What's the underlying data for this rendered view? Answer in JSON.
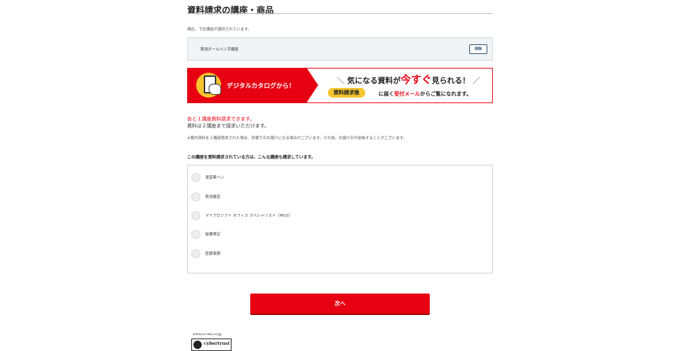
{
  "page": {
    "title": "資料請求の講座・商品",
    "current_note": "現在、下記講座が選択されています。"
  },
  "selected": {
    "course_name": "実用ボールペン字講座",
    "delete_label": "削除"
  },
  "banner": {
    "left_text": "デジタルカタログから！",
    "headline_prefix": "気になる資料が",
    "headline_emphasis": "今すぐ",
    "headline_suffix": "見られる！",
    "slash_left": "＼",
    "slash_right": "／",
    "pill": "資料請求後",
    "sub_prefix": "に届く",
    "sub_red": "受付メール",
    "sub_suffix": "からご覧になれます。"
  },
  "remaining": {
    "red_line": "あと１講座資料請求できます。",
    "black_line": "資料は２講座まで請求いただけます。",
    "note": "※案内資料を２講座請求された場合、別便でのお届けになる場合がございます。その為、お届け日が前後することがございます。"
  },
  "others": {
    "heading": "この講座を資料請求されている方は、こんな講座も請求しています。",
    "options": [
      {
        "label": "速習筆ペン"
      },
      {
        "label": "実用書道"
      },
      {
        "label": "マイクロソフト オフィス スペシャリスト（MOS）"
      },
      {
        "label": "秘書検定"
      },
      {
        "label": "医療事務"
      }
    ]
  },
  "actions": {
    "next_label": "次へ"
  },
  "seal": {
    "domain": "www.u-can.co.jp",
    "brand": "cybertrust"
  },
  "colors": {
    "accent_red": "#e60012",
    "banner_yellow": "#f5c530",
    "delete_blue": "#2a4d6b"
  }
}
